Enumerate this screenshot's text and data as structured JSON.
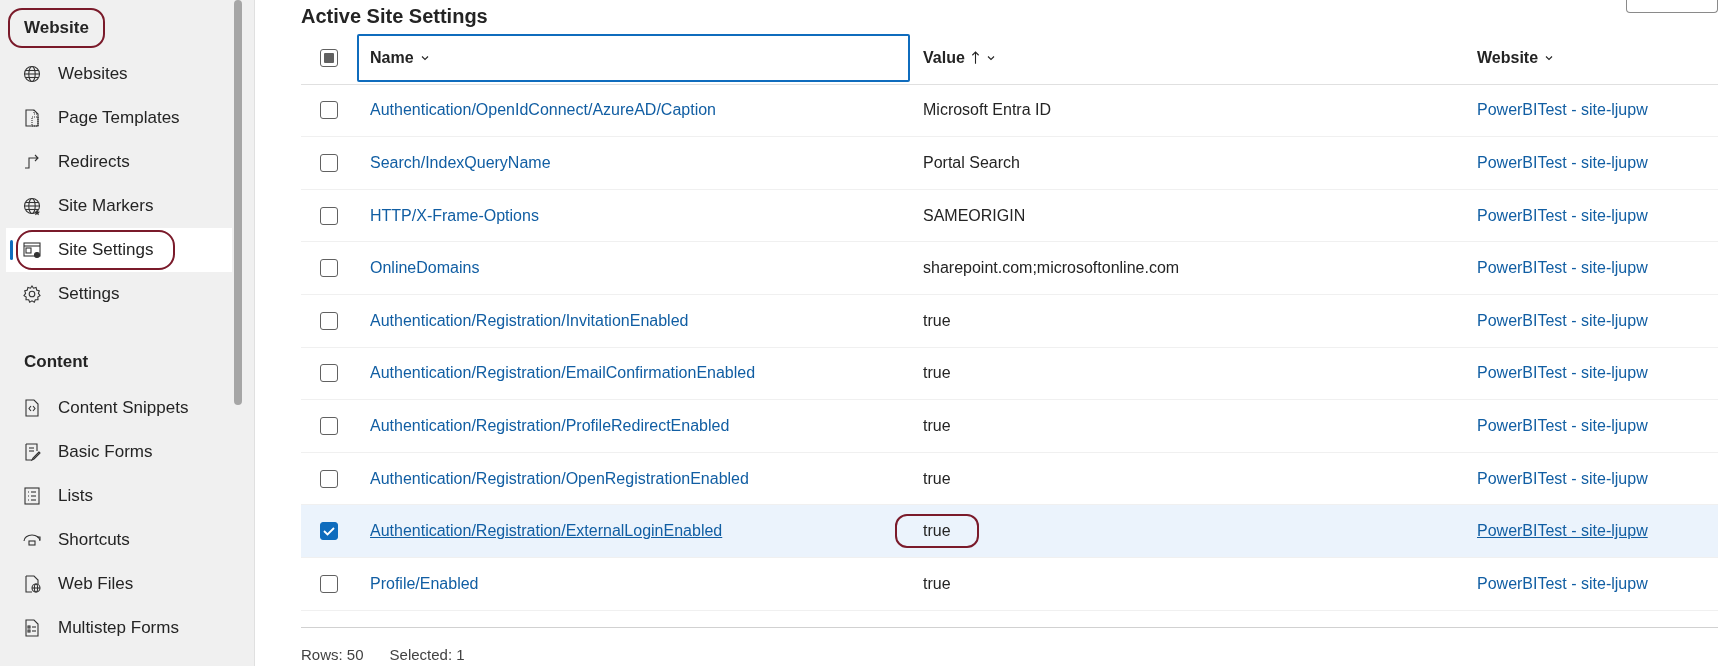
{
  "sidebar": {
    "sections": [
      {
        "title": "Website",
        "highlighted": true,
        "items": [
          {
            "label": "Websites",
            "kind": "globe",
            "selected": false,
            "highlighted": false
          },
          {
            "label": "Page Templates",
            "kind": "page",
            "selected": false,
            "highlighted": false
          },
          {
            "label": "Redirects",
            "kind": "redirect",
            "selected": false,
            "highlighted": false
          },
          {
            "label": "Site Markers",
            "kind": "globe-star",
            "selected": false,
            "highlighted": false
          },
          {
            "label": "Site Settings",
            "kind": "window-gear",
            "selected": true,
            "highlighted": true
          },
          {
            "label": "Settings",
            "kind": "gear",
            "selected": false,
            "highlighted": false
          }
        ]
      },
      {
        "title": "Content",
        "highlighted": false,
        "items": [
          {
            "label": "Content Snippets",
            "kind": "code",
            "selected": false,
            "highlighted": false
          },
          {
            "label": "Basic Forms",
            "kind": "form",
            "selected": false,
            "highlighted": false
          },
          {
            "label": "Lists",
            "kind": "list",
            "selected": false,
            "highlighted": false
          },
          {
            "label": "Shortcuts",
            "kind": "shortcut",
            "selected": false,
            "highlighted": false
          },
          {
            "label": "Web Files",
            "kind": "page-globe",
            "selected": false,
            "highlighted": false
          },
          {
            "label": "Multistep Forms",
            "kind": "multiform",
            "selected": false,
            "highlighted": false
          }
        ]
      }
    ]
  },
  "main": {
    "title": "Active Site Settings",
    "table": {
      "select_all": {
        "partial": true
      },
      "columns": [
        {
          "label": "Name",
          "focused": true,
          "sorted_ascending": false
        },
        {
          "label": "Value",
          "focused": false,
          "sorted_ascending": true
        },
        {
          "label": "Website",
          "focused": false,
          "sorted_ascending": false
        }
      ],
      "rows": [
        {
          "name": "Authentication/OpenIdConnect/AzureAD/Caption",
          "value": "Microsoft Entra ID",
          "website": "PowerBITest - site-ljupw",
          "selected": false,
          "value_highlighted": false
        },
        {
          "name": "Search/IndexQueryName",
          "value": "Portal Search",
          "website": "PowerBITest - site-ljupw",
          "selected": false,
          "value_highlighted": false
        },
        {
          "name": "HTTP/X-Frame-Options",
          "value": "SAMEORIGIN",
          "website": "PowerBITest - site-ljupw",
          "selected": false,
          "value_highlighted": false
        },
        {
          "name": "OnlineDomains",
          "value": "sharepoint.com;microsoftonline.com",
          "website": "PowerBITest - site-ljupw",
          "selected": false,
          "value_highlighted": false
        },
        {
          "name": "Authentication/Registration/InvitationEnabled",
          "value": "true",
          "website": "PowerBITest - site-ljupw",
          "selected": false,
          "value_highlighted": false
        },
        {
          "name": "Authentication/Registration/EmailConfirmationEnabled",
          "value": "true",
          "website": "PowerBITest - site-ljupw",
          "selected": false,
          "value_highlighted": false
        },
        {
          "name": "Authentication/Registration/ProfileRedirectEnabled",
          "value": "true",
          "website": "PowerBITest - site-ljupw",
          "selected": false,
          "value_highlighted": false
        },
        {
          "name": "Authentication/Registration/OpenRegistrationEnabled",
          "value": "true",
          "website": "PowerBITest - site-ljupw",
          "selected": false,
          "value_highlighted": false
        },
        {
          "name": "Authentication/Registration/ExternalLoginEnabled",
          "value": "true",
          "website": "PowerBITest - site-ljupw",
          "selected": true,
          "value_highlighted": true
        },
        {
          "name": "Profile/Enabled",
          "value": "true",
          "website": "PowerBITest - site-ljupw",
          "selected": false,
          "value_highlighted": false
        }
      ]
    },
    "footer": {
      "rows": "Rows: 50",
      "selected": "Selected: 1"
    }
  }
}
